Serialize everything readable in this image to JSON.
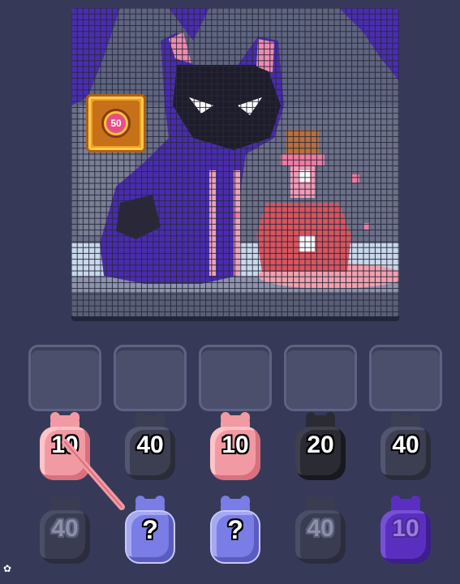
{
  "bonus": {
    "value": "50"
  },
  "slots": [
    {},
    {},
    {},
    {},
    {}
  ],
  "row1": [
    {
      "label": "10",
      "color": "pink"
    },
    {
      "label": "40",
      "color": "gray"
    },
    {
      "label": "10",
      "color": "pink"
    },
    {
      "label": "20",
      "color": "black"
    },
    {
      "label": "40",
      "color": "gray"
    }
  ],
  "row2": [
    {
      "label": "40",
      "color": "faded"
    },
    {
      "label": "?",
      "color": "mystery"
    },
    {
      "label": "?",
      "color": "mystery"
    },
    {
      "label": "40",
      "color": "faded"
    },
    {
      "label": "10",
      "color": "purple"
    }
  ],
  "colors": {
    "pink": "#f29aa3",
    "purple": "#5a2fc0",
    "board_bg": "#6a6f86",
    "cat": "#4a2bb0",
    "potion": "#d8545f"
  }
}
